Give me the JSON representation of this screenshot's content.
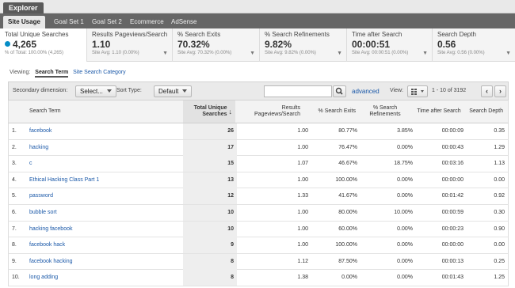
{
  "explorer": {
    "label": "Explorer"
  },
  "tabs": [
    {
      "label": "Site Usage"
    },
    {
      "label": "Goal Set 1"
    },
    {
      "label": "Goal Set 2"
    },
    {
      "label": "Ecommerce"
    },
    {
      "label": "AdSense"
    }
  ],
  "metrics": [
    {
      "label": "Total Unique Searches",
      "value": "4,265",
      "sub": "% of Total: 100.00% (4,265)"
    },
    {
      "label": "Results Pageviews/Search",
      "value": "1.10",
      "sub": "Site Avg: 1.10 (0.00%)"
    },
    {
      "label": "% Search Exits",
      "value": "70.32%",
      "sub": "Site Avg: 70.32% (0.00%)"
    },
    {
      "label": "% Search Refinements",
      "value": "9.82%",
      "sub": "Site Avg: 9.82% (0.00%)"
    },
    {
      "label": "Time after Search",
      "value": "00:00:51",
      "sub": "Site Avg: 00:00:51 (0.00%)"
    },
    {
      "label": "Search Depth",
      "value": "0.56",
      "sub": "Site Avg: 0.56 (0.00%)"
    }
  ],
  "viewing": {
    "label": "Viewing:",
    "active": "Search Term",
    "other": "Site Search Category"
  },
  "toolbar": {
    "secondary_label": "Secondary dimension:",
    "secondary_value": "Select...",
    "sort_label": "Sort Type:",
    "sort_value": "Default",
    "search_value": "",
    "advanced": "advanced",
    "view_label": "View:",
    "pager": "1 - 10 of 3192",
    "prev": "‹",
    "next": "›"
  },
  "table": {
    "headers": {
      "term": "Search Term",
      "unique": "Total Unique Searches",
      "results": "Results Pageviews/Search",
      "exits": "% Search Exits",
      "refinements": "% Search Refinements",
      "time": "Time after Search",
      "depth": "Search Depth"
    },
    "rows": [
      {
        "idx": "1.",
        "term": "facebook",
        "unique": "26",
        "results": "1.00",
        "exits": "80.77%",
        "refinements": "3.85%",
        "time": "00:00:09",
        "depth": "0.35"
      },
      {
        "idx": "2.",
        "term": "hacking",
        "unique": "17",
        "results": "1.00",
        "exits": "76.47%",
        "refinements": "0.00%",
        "time": "00:00:43",
        "depth": "1.29"
      },
      {
        "idx": "3.",
        "term": "c",
        "unique": "15",
        "results": "1.07",
        "exits": "46.67%",
        "refinements": "18.75%",
        "time": "00:03:16",
        "depth": "1.13"
      },
      {
        "idx": "4.",
        "term": "Ethical Hacking Class Part 1",
        "unique": "13",
        "results": "1.00",
        "exits": "100.00%",
        "refinements": "0.00%",
        "time": "00:00:00",
        "depth": "0.00"
      },
      {
        "idx": "5.",
        "term": "password",
        "unique": "12",
        "results": "1.33",
        "exits": "41.67%",
        "refinements": "0.00%",
        "time": "00:01:42",
        "depth": "0.92"
      },
      {
        "idx": "6.",
        "term": "bubble sort",
        "unique": "10",
        "results": "1.00",
        "exits": "80.00%",
        "refinements": "10.00%",
        "time": "00:00:59",
        "depth": "0.30"
      },
      {
        "idx": "7.",
        "term": "hacking facebook",
        "unique": "10",
        "results": "1.00",
        "exits": "60.00%",
        "refinements": "0.00%",
        "time": "00:00:23",
        "depth": "0.90"
      },
      {
        "idx": "8.",
        "term": "facebook hack",
        "unique": "9",
        "results": "1.00",
        "exits": "100.00%",
        "refinements": "0.00%",
        "time": "00:00:00",
        "depth": "0.00"
      },
      {
        "idx": "9.",
        "term": "facebook hacking",
        "unique": "8",
        "results": "1.12",
        "exits": "87.50%",
        "refinements": "0.00%",
        "time": "00:00:13",
        "depth": "0.25"
      },
      {
        "idx": "10.",
        "term": "long adding",
        "unique": "8",
        "results": "1.38",
        "exits": "0.00%",
        "refinements": "0.00%",
        "time": "00:01:43",
        "depth": "1.25"
      }
    ]
  },
  "icons": {
    "search": "search-icon",
    "view": "grid-view-icon",
    "dropdown": "chevron-down-icon",
    "sort": "sort-desc-arrow-icon"
  },
  "colors": {
    "accent_link": "#1a58a8",
    "metric_dot": "#058dc7",
    "tab_bar": "#666666"
  }
}
